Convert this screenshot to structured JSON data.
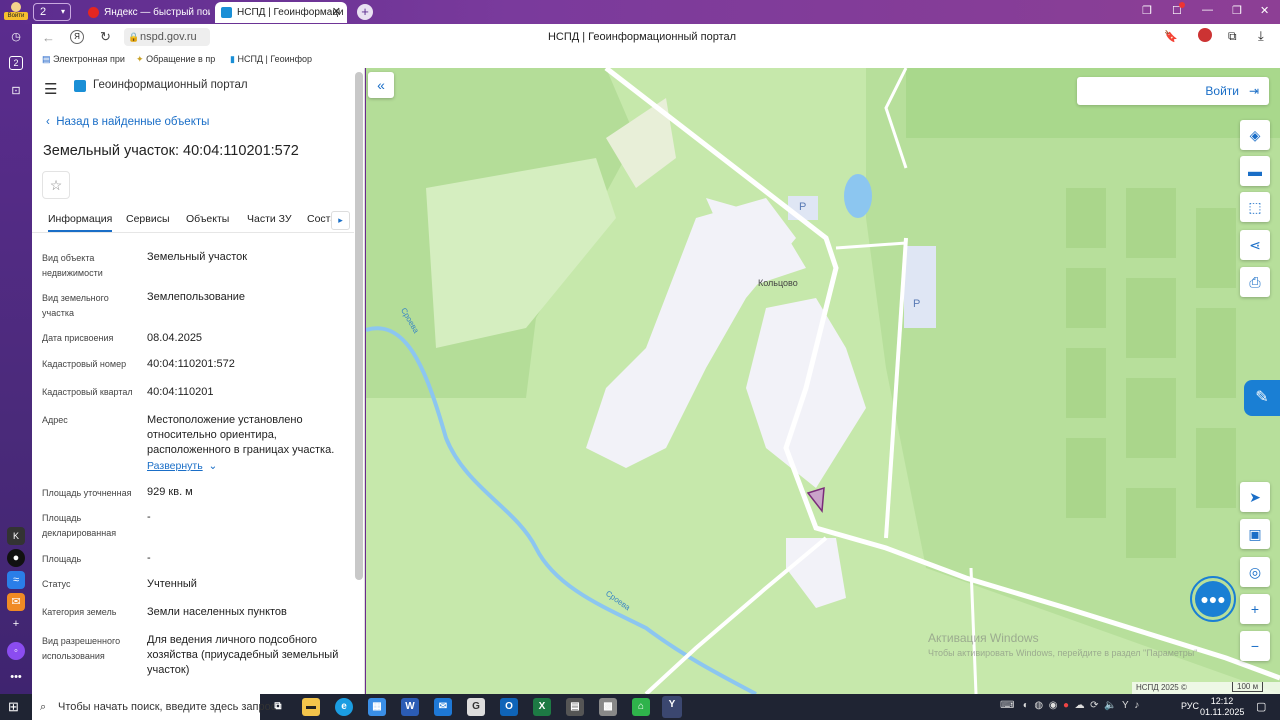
{
  "browser": {
    "profile_label": "Войти",
    "tab_count": "2",
    "tabs": [
      {
        "label": "Яндекс — быстрый поиск"
      },
      {
        "label": "НСПД | Геоинформаци"
      }
    ],
    "url": "nspd.gov.ru",
    "page_title": "НСПД | Геоинформационный портал",
    "bookmarks": [
      {
        "label": "Электронная при"
      },
      {
        "label": "Обращение в пр"
      },
      {
        "label": "НСПД | Геоинфор"
      }
    ]
  },
  "panel": {
    "portal_title": "Геоинформационный портал",
    "back_link": "Назад в найденные объекты",
    "object_title": "Земельный участок: 40:04:110201:572",
    "tabs": [
      {
        "label": "Информация"
      },
      {
        "label": "Сервисы"
      },
      {
        "label": "Объекты"
      },
      {
        "label": "Части ЗУ"
      },
      {
        "label": "Соста"
      }
    ],
    "rows": [
      {
        "label": "Вид объекта недвижимости",
        "value": "Земельный участок"
      },
      {
        "label": "Вид земельного участка",
        "value": "Землепользование"
      },
      {
        "label": "Дата присвоения",
        "value": "08.04.2025"
      },
      {
        "label": "Кадастровый номер",
        "value": "40:04:110201:572"
      },
      {
        "label": "Кадастровый квартал",
        "value": "40:04:110201"
      },
      {
        "label": "Адрес",
        "value": "Местоположение установлено относительно ориентира, расположенного в границах участка."
      },
      {
        "label": "Площадь уточненная",
        "value": "929 кв. м"
      },
      {
        "label": "Площадь декларированная",
        "value": "-"
      },
      {
        "label": "Площадь",
        "value": "-"
      },
      {
        "label": "Статус",
        "value": "Учтенный"
      },
      {
        "label": "Категория земель",
        "value": "Земли населенных пунктов"
      },
      {
        "label": "Вид разрешенного использования",
        "value": "Для ведения личного подсобного хозяйства (приусадебный земельный участок)"
      }
    ],
    "expand_link": "Развернуть"
  },
  "map": {
    "login_label": "Войти",
    "village_label": "Кольцово",
    "river_label_1": "Сроева",
    "river_label_2": "Сроева",
    "parking_label": "P",
    "watermark_1": "Активация Windows",
    "watermark_2": "Чтобы активировать Windows, перейдите в раздел \"Параметры\"",
    "copyright": "НСПД 2025 ©",
    "scale": "100 м",
    "zoom_in": "+",
    "zoom_out": "−",
    "colors": {
      "accent": "#1a6ec7",
      "chat": "#1a7fd4"
    }
  },
  "taskbar": {
    "search_placeholder": "Чтобы начать поиск, введите здесь запрос",
    "lang": "РУС",
    "time": "12:12",
    "date": "01.11.2025"
  }
}
